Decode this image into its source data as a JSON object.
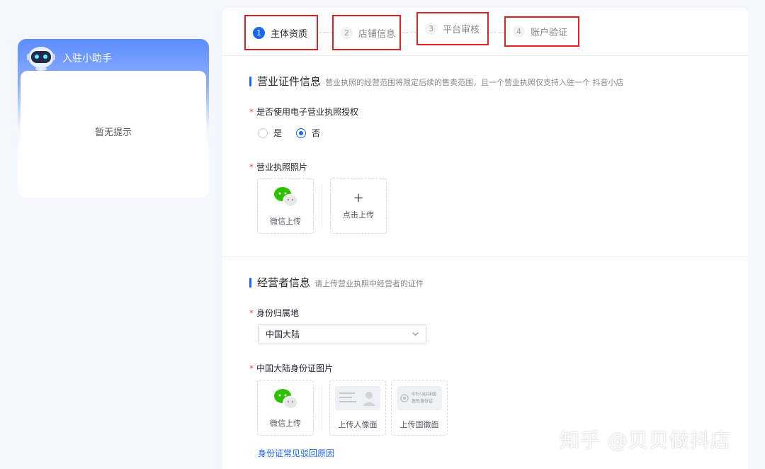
{
  "assistant": {
    "title": "入驻小助手",
    "empty_text": "暂无提示"
  },
  "steps": [
    {
      "num": "1",
      "label": "主体资质",
      "active": true
    },
    {
      "num": "2",
      "label": "店铺信息",
      "active": false
    },
    {
      "num": "3",
      "label": "平台审核",
      "active": false
    },
    {
      "num": "4",
      "label": "账户验证",
      "active": false
    }
  ],
  "license_section": {
    "title": "营业证件信息",
    "desc": "营业执照的经营范围将限定后续的售卖范围，且一个营业执照仅支持入驻一个 抖音小店",
    "e_license_label": "是否使用电子营业执照授权",
    "radio_yes": "是",
    "radio_no": "否",
    "selected": "否",
    "photo_label": "营业执照照片",
    "wechat_upload": "微信上传",
    "click_upload": "点击上传",
    "plus": "+"
  },
  "operator_section": {
    "title": "经营者信息",
    "desc": "请上传营业执照中经营者的证件",
    "region_label": "身份归属地",
    "region_value": "中国大陆",
    "id_photo_label": "中国大陆身份证图片",
    "wechat_upload": "微信上传",
    "portrait_upload": "上传人像面",
    "emblem_upload": "上传国徽面",
    "id_card_back_line1": "中华人民共和国",
    "id_card_back_line2": "居民身份证",
    "help_link": "身份证常见驳回原因"
  },
  "watermark": "知乎 @贝贝做抖店",
  "colors": {
    "primary": "#1966ff",
    "required": "#f54a45",
    "annotation_box": "#e02020",
    "wechat_green": "#2dc100"
  }
}
